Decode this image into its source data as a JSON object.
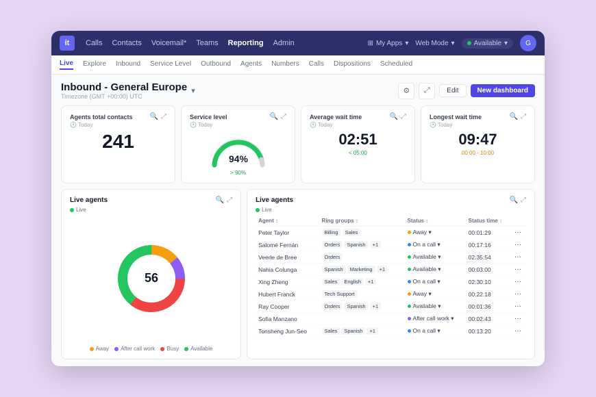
{
  "browser": {
    "logo": "it"
  },
  "topnav": {
    "links": [
      {
        "label": "Calls",
        "active": false
      },
      {
        "label": "Contacts",
        "active": false
      },
      {
        "label": "Voicemail*",
        "active": false
      },
      {
        "label": "Teams",
        "active": false
      },
      {
        "label": "Reporting",
        "active": true
      },
      {
        "label": "Admin",
        "active": false
      }
    ],
    "myApps": "My Apps",
    "webMode": "Web Mode",
    "available": "Available",
    "avatarInitial": "G"
  },
  "subnav": {
    "links": [
      {
        "label": "Live",
        "active": true
      },
      {
        "label": "Explore",
        "active": false
      },
      {
        "label": "Inbound",
        "active": false
      },
      {
        "label": "Service Level",
        "active": false
      },
      {
        "label": "Outbound",
        "active": false
      },
      {
        "label": "Agents",
        "active": false
      },
      {
        "label": "Numbers",
        "active": false
      },
      {
        "label": "Calls",
        "active": false
      },
      {
        "label": "Dispositions",
        "active": false
      },
      {
        "label": "Scheduled",
        "active": false
      }
    ]
  },
  "dashboard": {
    "title": "Inbound - General Europe",
    "timezone": "Timezone (GMT +00:00) UTC",
    "editLabel": "Edit",
    "newDashboardLabel": "New dashboard"
  },
  "kpis": [
    {
      "label": "Agents total contacts",
      "sub": "Today",
      "value": "241",
      "badge": "",
      "badgeClass": ""
    },
    {
      "label": "Service level",
      "sub": "Today",
      "value": "94%",
      "badge": "> 90%",
      "badgeClass": "badge-green",
      "isGauge": true
    },
    {
      "label": "Average wait time",
      "sub": "Today",
      "value": "02:51",
      "badge": "< 05:00",
      "badgeClass": "badge-green"
    },
    {
      "label": "Longest wait time",
      "sub": "Today",
      "value": "09:47",
      "badge": "00:00 - 10:00",
      "badgeClass": "badge-yellow"
    }
  ],
  "liveAgentsDonut": {
    "title": "Live agents",
    "legendLive": "Live",
    "total": "56",
    "segments": [
      {
        "label": "Away",
        "color": "#f59e0b",
        "value": 8,
        "percent": 14
      },
      {
        "label": "After call work",
        "color": "#8b5cf6",
        "value": 6,
        "percent": 11
      },
      {
        "label": "Busy",
        "color": "#ef4444",
        "value": 20,
        "percent": 36
      },
      {
        "label": "Available",
        "color": "#22c55e",
        "value": 22,
        "percent": 39
      }
    ]
  },
  "liveAgentsTable": {
    "title": "Live agents",
    "legendLive": "Live",
    "columns": [
      "Agent",
      "Ring groups",
      "Status",
      "Status time"
    ],
    "rows": [
      {
        "agent": "Peter Taylor",
        "tags": [
          "Billing",
          "Sales"
        ],
        "tagColors": [
          "default",
          "default"
        ],
        "status": "Away",
        "statusClass": "dot-away",
        "statusTime": "00:01:29"
      },
      {
        "agent": "Salomé Fernán",
        "tags": [
          "Orders",
          "Spanish"
        ],
        "tagColors": [
          "default",
          "default"
        ],
        "extraTag": "+1",
        "status": "On a call",
        "statusClass": "dot-oncall",
        "statusTime": "00:17:16"
      },
      {
        "agent": "Veerle de Bree",
        "tags": [
          "Orders"
        ],
        "tagColors": [
          "default"
        ],
        "status": "Available",
        "statusClass": "dot-available",
        "statusTime": "02:35:54"
      },
      {
        "agent": "Nahia Colunga",
        "tags": [
          "Spanish",
          "Marketing"
        ],
        "tagColors": [
          "default",
          "default"
        ],
        "extraTag": "+1",
        "status": "Available",
        "statusClass": "dot-available",
        "statusTime": "00:03:00"
      },
      {
        "agent": "Xing Zheng",
        "tags": [
          "Sales",
          "English"
        ],
        "tagColors": [
          "default",
          "default"
        ],
        "extraTag": "+1",
        "status": "On a call",
        "statusClass": "dot-oncall",
        "statusTime": "02:30:10"
      },
      {
        "agent": "Hubert Franck",
        "tags": [
          "Tech Support"
        ],
        "tagColors": [
          "default"
        ],
        "status": "Away",
        "statusClass": "dot-away",
        "statusTime": "00:22:18"
      },
      {
        "agent": "Ray Cooper",
        "tags": [
          "Orders",
          "Spanish"
        ],
        "tagColors": [
          "default",
          "default"
        ],
        "extraTag": "+1",
        "status": "Available",
        "statusClass": "dot-available",
        "statusTime": "00:01:36"
      },
      {
        "agent": "Sofia Manzano",
        "tags": [],
        "status": "After call work",
        "statusClass": "dot-aftercall",
        "statusTime": "00:02:43"
      },
      {
        "agent": "Tonsheng Jun-Seo",
        "tags": [
          "Sales",
          "Spanish"
        ],
        "tagColors": [
          "default",
          "default"
        ],
        "extraTag": "+1",
        "status": "On a call",
        "statusClass": "dot-oncall",
        "statusTime": "00:13:20"
      }
    ]
  },
  "gauge": {
    "value": 94,
    "color": "#22c55e",
    "trackColor": "#e5e7eb",
    "size": 80
  }
}
